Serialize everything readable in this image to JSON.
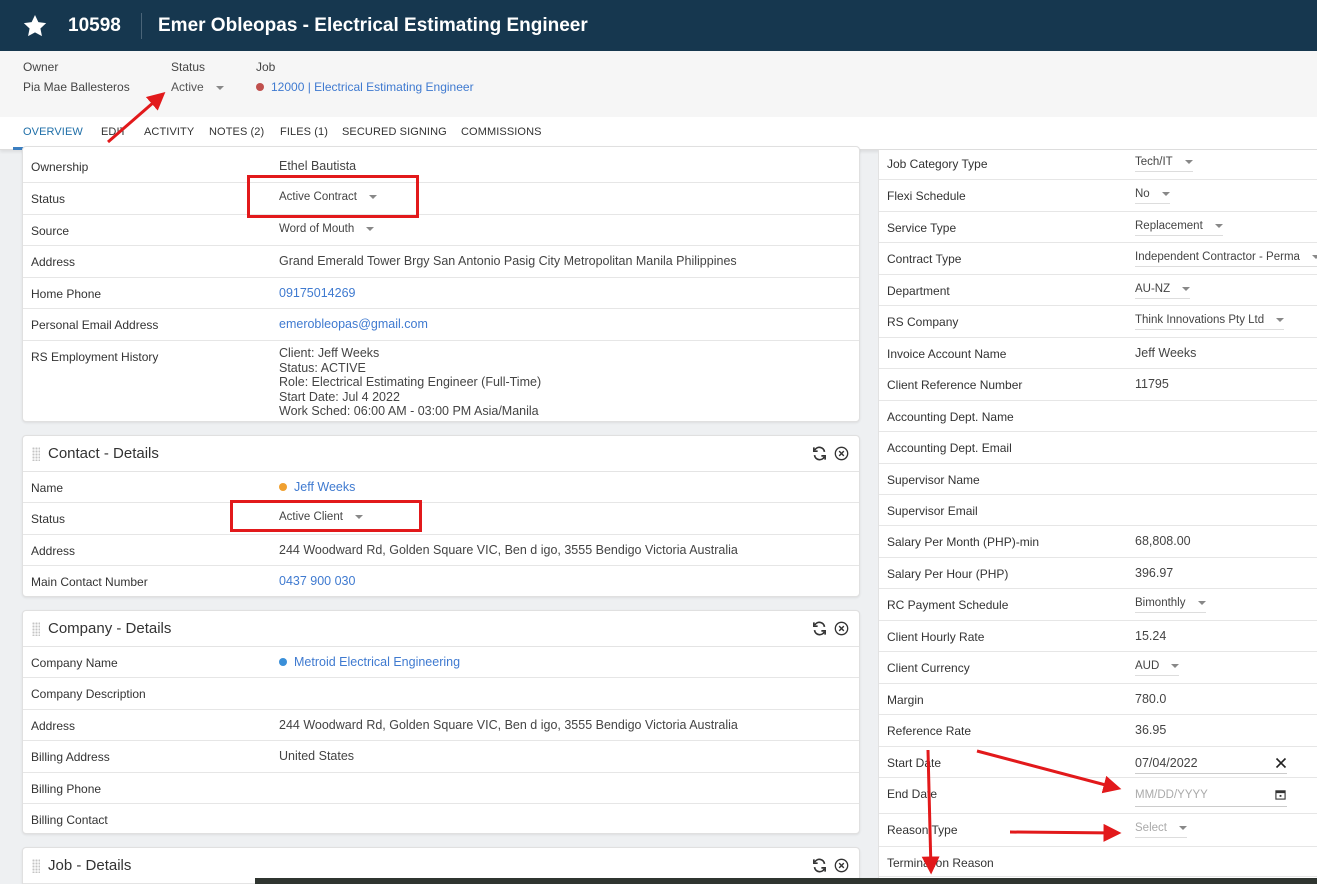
{
  "header": {
    "record_id": "10598",
    "title": "Emer Obleopas - Electrical Estimating Engineer",
    "bg_color": "#16374f"
  },
  "meta": {
    "owner_label": "Owner",
    "owner_value": "Pia Mae Ballesteros",
    "status_label": "Status",
    "status_value": "Active",
    "job_label": "Job",
    "job_value": "12000 | Electrical Estimating Engineer",
    "job_dot_color": "#c0504d"
  },
  "tabs": [
    "OVERVIEW",
    "EDIT",
    "ACTIVITY",
    "NOTES (2)",
    "FILES (1)",
    "SECURED SIGNING",
    "COMMISSIONS"
  ],
  "candidate_panel": {
    "rows": {
      "ownership": {
        "label": "Ownership",
        "value": "Ethel Bautista"
      },
      "status": {
        "label": "Status",
        "value": "Active Contract"
      },
      "source": {
        "label": "Source",
        "value": "Word of Mouth"
      },
      "address": {
        "label": "Address",
        "value": "Grand Emerald Tower Brgy San Antonio Pasig City Metropolitan Manila Philippines"
      },
      "home_phone": {
        "label": "Home Phone",
        "value": "09175014269"
      },
      "email": {
        "label": "Personal Email Address",
        "value": "emerobleopas@gmail.com"
      },
      "history": {
        "label": "RS Employment History",
        "lines": [
          "Client: Jeff Weeks",
          "Status: ACTIVE",
          "Role: Electrical Estimating Engineer (Full-Time)",
          "Start Date: Jul 4 2022",
          "Work Sched: 06:00 AM - 03:00 PM Asia/Manila"
        ]
      }
    }
  },
  "contact_panel": {
    "title": "Contact - Details",
    "rows": {
      "name": {
        "label": "Name",
        "value": "Jeff Weeks",
        "dot_color": "#f0a030"
      },
      "status": {
        "label": "Status",
        "value": "Active Client"
      },
      "address": {
        "label": "Address",
        "value": "244 Woodward Rd, Golden Square VIC, Ben d igo, 3555 Bendigo Victoria Australia"
      },
      "main_contact": {
        "label": "Main Contact Number",
        "value": "0437 900 030"
      }
    }
  },
  "company_panel": {
    "title": "Company - Details",
    "rows": {
      "name": {
        "label": "Company Name",
        "value": "Metroid Electrical Engineering",
        "dot_color": "#3a8fd8"
      },
      "description": {
        "label": "Company Description",
        "value": ""
      },
      "address": {
        "label": "Address",
        "value": "244 Woodward Rd, Golden Square VIC, Ben d igo, 3555 Bendigo Victoria Australia"
      },
      "billing_address": {
        "label": "Billing Address",
        "value": "United States"
      },
      "billing_phone": {
        "label": "Billing Phone",
        "value": ""
      },
      "billing_contact": {
        "label": "Billing Contact",
        "value": ""
      }
    }
  },
  "job_panel": {
    "title": "Job - Details"
  },
  "right_panel": {
    "rows": [
      {
        "label": "Job Category Type",
        "value": "Tech/IT",
        "kind": "dropdown"
      },
      {
        "label": "Flexi Schedule",
        "value": "No",
        "kind": "dropdown"
      },
      {
        "label": "Service Type",
        "value": "Replacement",
        "kind": "dropdown"
      },
      {
        "label": "Contract Type",
        "value": "Independent Contractor - Perma",
        "kind": "dropdown"
      },
      {
        "label": "Department",
        "value": "AU-NZ",
        "kind": "dropdown"
      },
      {
        "label": "RS Company",
        "value": "Think Innovations Pty Ltd",
        "kind": "dropdown"
      },
      {
        "label": "Invoice Account Name",
        "value": "Jeff Weeks",
        "kind": "text"
      },
      {
        "label": "Client Reference Number",
        "value": "11795",
        "kind": "text"
      },
      {
        "label": "Accounting Dept. Name",
        "value": "",
        "kind": "text"
      },
      {
        "label": "Accounting Dept. Email",
        "value": "",
        "kind": "text"
      },
      {
        "label": "Supervisor Name",
        "value": "",
        "kind": "text"
      },
      {
        "label": "Supervisor Email",
        "value": "",
        "kind": "text"
      },
      {
        "label": "Salary Per Month (PHP)-min",
        "value": "68,808.00",
        "kind": "text"
      },
      {
        "label": "Salary Per Hour (PHP)",
        "value": "396.97",
        "kind": "text"
      },
      {
        "label": "RC Payment Schedule",
        "value": "Bimonthly",
        "kind": "dropdown"
      },
      {
        "label": "Client Hourly Rate",
        "value": "15.24",
        "kind": "text"
      },
      {
        "label": "Client Currency",
        "value": "AUD",
        "kind": "dropdown"
      },
      {
        "label": "Margin",
        "value": "780.0",
        "kind": "text"
      },
      {
        "label": "Reference Rate",
        "value": "36.95",
        "kind": "text"
      },
      {
        "label": "Start Date",
        "value": "07/04/2022",
        "kind": "date"
      },
      {
        "label": "End Date",
        "value": "MM/DD/YYYY",
        "kind": "date-empty"
      },
      {
        "label": "Reason Type",
        "value": "Select",
        "kind": "dropdown-empty"
      },
      {
        "label": "Termination Reason",
        "value": "",
        "kind": "text"
      }
    ]
  },
  "annotation_color": "#e2191b"
}
